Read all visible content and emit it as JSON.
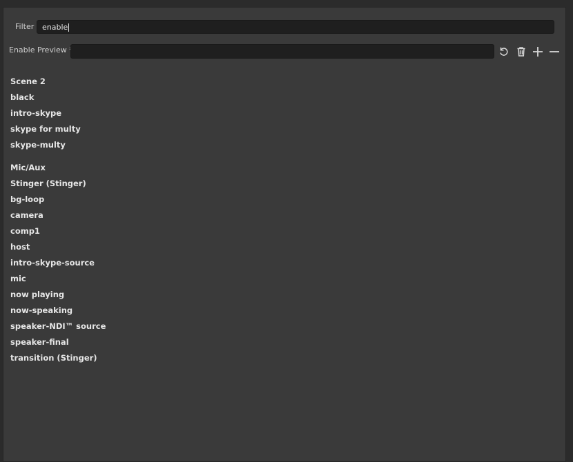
{
  "filter": {
    "label": "Filter",
    "value": "enable"
  },
  "hotkey": {
    "label": "Enable Preview *",
    "value": "",
    "actions": [
      "revert-icon",
      "trash-icon",
      "plus-icon",
      "minus-icon"
    ]
  },
  "scenes": [
    "Scene 2",
    "black",
    "intro-skype",
    "skype for multy",
    "skype-multy"
  ],
  "sources": [
    "Mic/Aux",
    "Stinger (Stinger)",
    "bg-loop",
    "camera",
    "comp1",
    "host",
    "intro-skype-source",
    "mic",
    "now playing",
    "now-speaking",
    "speaker-NDI™ source",
    "speaker-final",
    "transition (Stinger)"
  ]
}
